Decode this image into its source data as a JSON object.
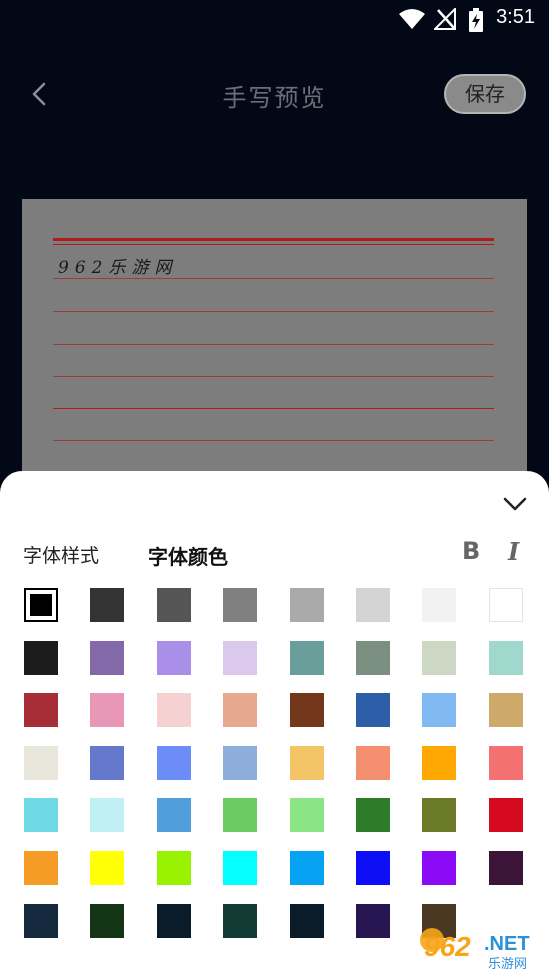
{
  "status_bar": {
    "time": "3:51"
  },
  "header": {
    "title": "手写预览",
    "save_label": "保存"
  },
  "preview": {
    "text": "962乐游网"
  },
  "panel": {
    "tabs": [
      {
        "label": "字体样式"
      },
      {
        "label": "字体颜色"
      }
    ],
    "bold_label": "B",
    "italic_label": "I"
  },
  "colors": {
    "selected": "#000000",
    "swatches": [
      "#000000",
      "#333333",
      "#555555",
      "#808080",
      "#aaaaaa",
      "#d4d4d4",
      "#f2f2f2",
      "#ffffff",
      "#1c1c1c",
      "#8469a8",
      "#a98fe8",
      "#dac9ea",
      "#6a9e9b",
      "#7b8f80",
      "#ccd8c4",
      "#a0d8cd",
      "#a72d36",
      "#e898b6",
      "#f5d1d1",
      "#e6a88e",
      "#73371c",
      "#2d5ea8",
      "#81baf3",
      "#cda96a",
      "#e9e6dc",
      "#6479cc",
      "#6c8df7",
      "#8daedb",
      "#f4c566",
      "#f48f6f",
      "#ffa804",
      "#f47171",
      "#6fd9e6",
      "#c0f0f3",
      "#509edc",
      "#6ccb63",
      "#8ce584",
      "#2c7c2a",
      "#6b7b27",
      "#d50a21",
      "#f49c25",
      "#ffff05",
      "#99f202",
      "#05ffff",
      "#06a3f2",
      "#0f0ff7",
      "#8b0bf7",
      "#3b1438",
      "#162a3f",
      "#133515",
      "#0a1b2a",
      "#133b35",
      "#0a1b2a",
      "#271552",
      "#4a3823"
    ]
  }
}
